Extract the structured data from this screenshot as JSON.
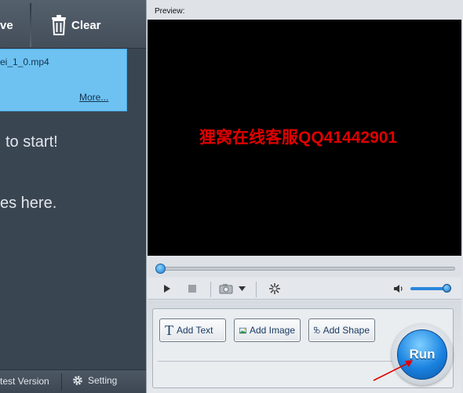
{
  "left_panel": {
    "toolbar": {
      "move_label": "ve",
      "clear_label": "Clear"
    },
    "file_item": {
      "name": "ei_1_0.mp4",
      "more_label": "More..."
    },
    "hint_start": "to start!",
    "hint_drop": "es here.",
    "bottom": {
      "latest_label": "test Version",
      "setting_label": "Setting"
    }
  },
  "preview": {
    "label": "Preview:",
    "overlay_text": "狸窝在线客服QQ41442901",
    "seek_position": 0.0,
    "volume_level": 1.0
  },
  "edit": {
    "add_text_label": "Add Text",
    "add_image_label": "Add Image",
    "add_shape_label": "Add Shape",
    "run_label": "Run"
  },
  "colors": {
    "accent_blue": "#1a82e0",
    "watermark_red": "#e00000",
    "sidebar_dark": "#3a4552",
    "file_card_blue": "#6ec2f2"
  }
}
